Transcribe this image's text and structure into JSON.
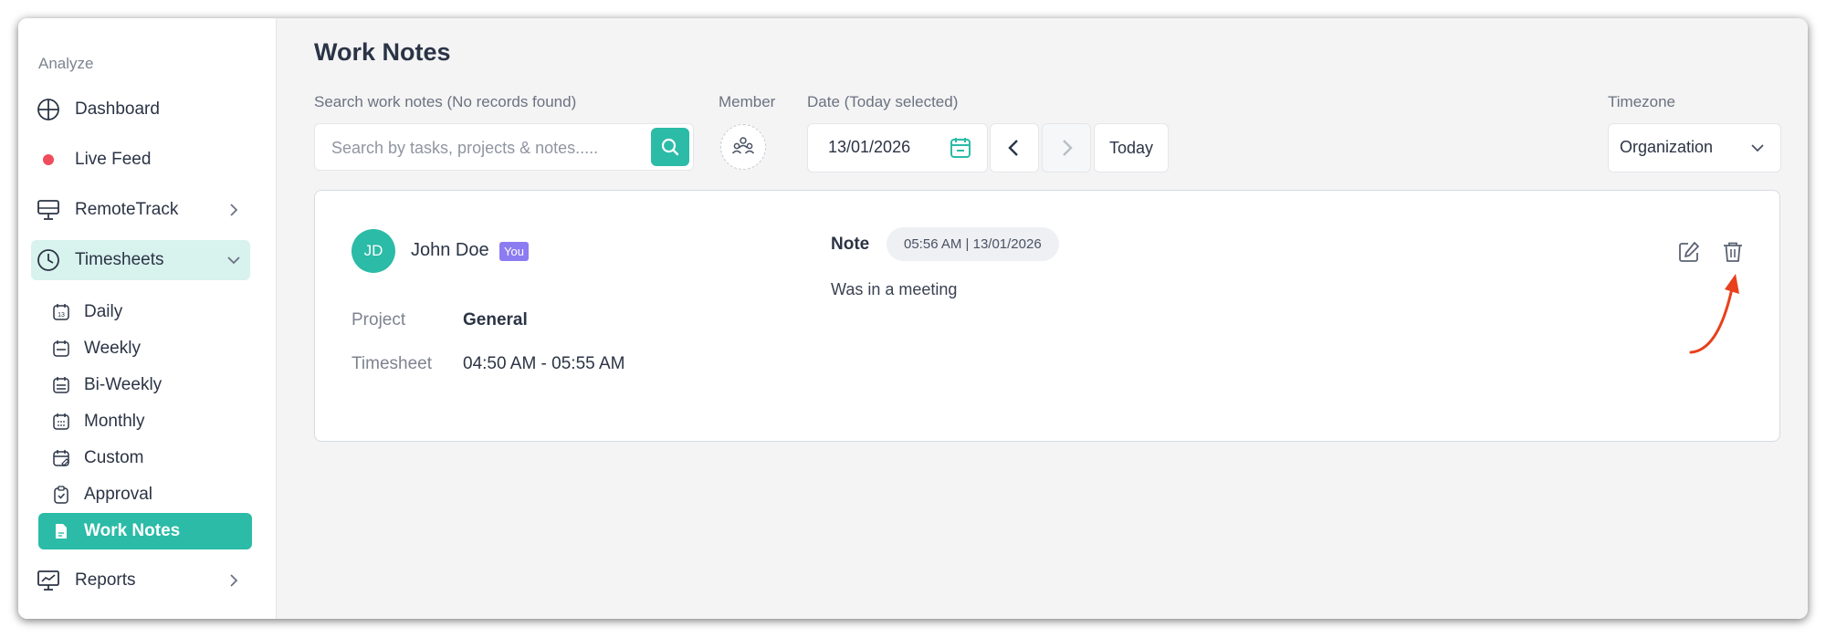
{
  "sidebar": {
    "section_label": "Analyze",
    "items": [
      {
        "label": "Dashboard",
        "icon": "grid-circle-icon"
      },
      {
        "label": "Live Feed",
        "icon": "live-dot-icon"
      },
      {
        "label": "RemoteTrack",
        "icon": "monitor-icon"
      },
      {
        "label": "Timesheets",
        "icon": "clock-icon",
        "expanded": true
      }
    ],
    "timesheet_subitems": [
      {
        "label": "Daily",
        "icon": "calendar-day-icon"
      },
      {
        "label": "Weekly",
        "icon": "calendar-week-icon"
      },
      {
        "label": "Bi-Weekly",
        "icon": "calendar-biweek-icon"
      },
      {
        "label": "Monthly",
        "icon": "calendar-month-icon"
      },
      {
        "label": "Custom",
        "icon": "calendar-edit-icon"
      },
      {
        "label": "Approval",
        "icon": "clipboard-check-icon"
      },
      {
        "label": "Work Notes",
        "icon": "document-icon",
        "active": true
      }
    ],
    "reports": {
      "label": "Reports",
      "icon": "presentation-chart-icon"
    }
  },
  "main": {
    "title": "Work Notes",
    "search": {
      "label": "Search work notes (No records found)",
      "placeholder": "Search by tasks, projects & notes....."
    },
    "member": {
      "label": "Member"
    },
    "date": {
      "label": "Date (Today selected)",
      "value": "13/01/2026",
      "today_label": "Today"
    },
    "timezone": {
      "label": "Timezone",
      "value": "Organization"
    }
  },
  "note_card": {
    "avatar_initials": "JD",
    "user_name": "John Doe",
    "you_badge": "You",
    "project_label": "Project",
    "project_value": "General",
    "timesheet_label": "Timesheet",
    "timesheet_value": "04:50 AM - 05:55 AM",
    "note_label": "Note",
    "note_time": "05:56 AM | 13/01/2026",
    "note_text": "Was in a meeting"
  },
  "colors": {
    "accent": "#2bbba7",
    "accent_light": "#d8f2ee",
    "badge": "#8b7cf2",
    "live_dot": "#f04c5b",
    "annotation_arrow": "#e8401c"
  }
}
